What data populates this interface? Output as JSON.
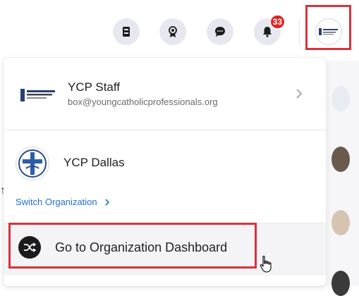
{
  "topbar": {
    "notification_count": "33",
    "icons": [
      "bookmark-icon",
      "award-icon",
      "chat-icon",
      "bell-icon"
    ]
  },
  "account": {
    "name": "YCP Staff",
    "email": "box@youngcatholicprofessionals.org"
  },
  "organization": {
    "name": "YCP Dallas",
    "switch_label": "Switch Organization"
  },
  "dashboard": {
    "label": "Go to Organization Dashboard"
  },
  "colors": {
    "accent_link": "#1f6fd1",
    "badge": "#e02424",
    "highlight_box": "#d9323a"
  }
}
